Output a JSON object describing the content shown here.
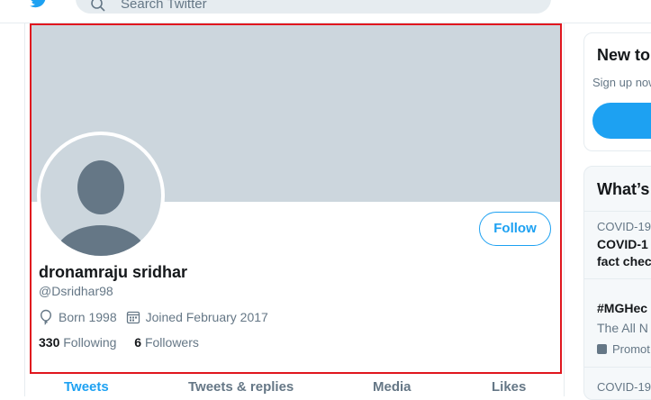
{
  "header": {
    "search_placeholder": "Search Twitter"
  },
  "profile": {
    "name": "dronamraju sridhar",
    "handle": "@Dsridhar98",
    "born": "Born 1998",
    "joined": "Joined February 2017",
    "following_count": "330",
    "following_label": "Following",
    "followers_count": "6",
    "followers_label": "Followers",
    "follow_label": "Follow"
  },
  "tabs": [
    {
      "label": "Tweets",
      "active": true
    },
    {
      "label": "Tweets & replies",
      "active": false
    },
    {
      "label": "Media",
      "active": false
    },
    {
      "label": "Likes",
      "active": false
    }
  ],
  "sidebar": {
    "new_title": "New to",
    "new_sub": "Sign up now",
    "trends_title": "What’s",
    "trends": [
      {
        "category": "COVID-19",
        "title": "COVID-1",
        "title2": "fact chec"
      },
      {
        "title": "#MGHec",
        "desc": "The All N",
        "promo": "Promot"
      },
      {
        "category": "COVID-19"
      }
    ]
  },
  "colors": {
    "accent": "#1da1f2",
    "highlight_border": "#e0161e",
    "banner": "#ccd6dd"
  }
}
